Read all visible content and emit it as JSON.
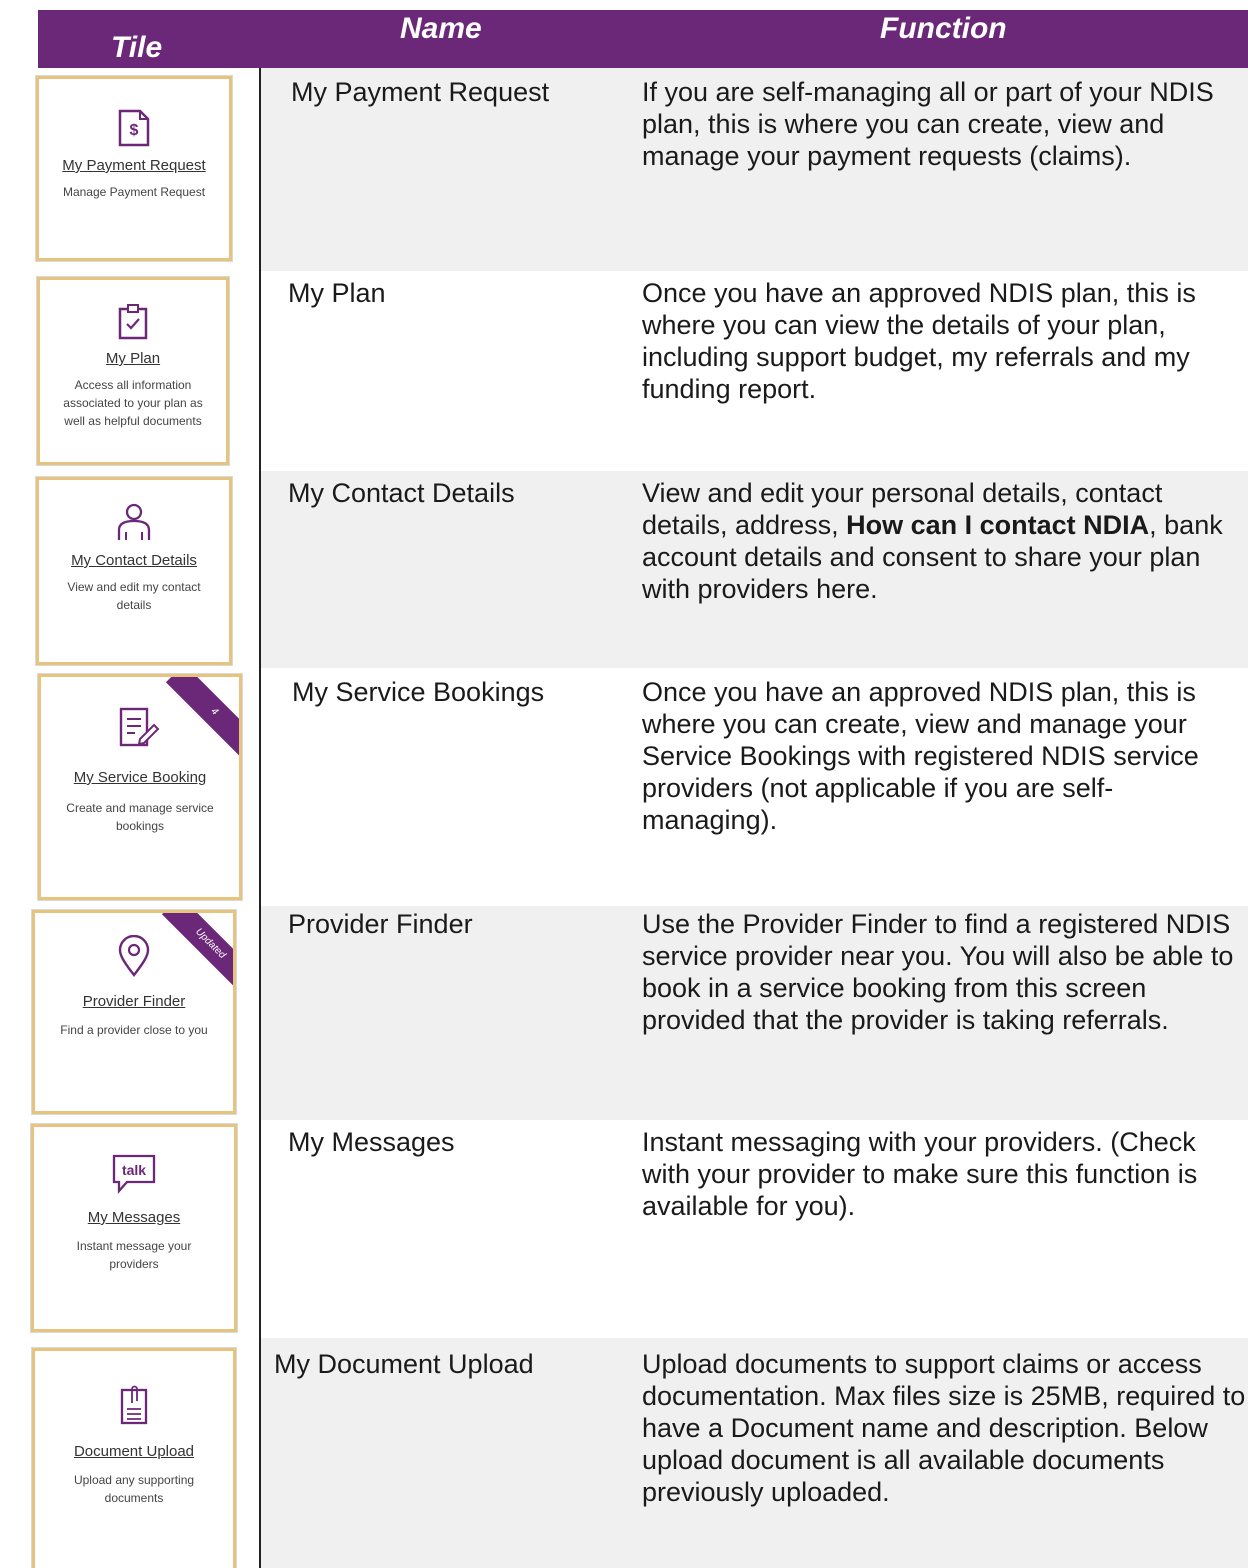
{
  "header": {
    "tile": "Tile",
    "name": "Name",
    "function": "Function"
  },
  "colors": {
    "header_bg": "#6b2878",
    "tile_border": "#e6c47f",
    "row_shade": "#f0f0f0",
    "ribbon": "#6b2878"
  },
  "rows": [
    {
      "tile": {
        "title": "My Payment Request",
        "desc": "Manage Payment Request",
        "icon": "dollar-document-icon",
        "icon_text": "$"
      },
      "name": "My Payment Request",
      "function": "If you are self-managing all or part of your NDIS plan, this is where you can create, view and manage your payment requests (claims)."
    },
    {
      "tile": {
        "title": "My Plan",
        "desc": "Access all information associated to your plan as well as helpful documents",
        "icon": "clipboard-check-icon"
      },
      "name": "My Plan",
      "function": "Once you have an approved NDIS plan, this is where you can view the details of your plan, including support budget, my referrals and my funding report."
    },
    {
      "tile": {
        "title": "My Contact Details",
        "desc": "View and edit my contact details",
        "icon": "person-icon"
      },
      "name": "My Contact Details",
      "function_before": "View and edit your personal details, contact details, address, ",
      "function_bold": "How can I contact NDIA",
      "function_after": ", bank account details and consent to share your plan with providers here."
    },
    {
      "tile": {
        "title": "My Service Booking",
        "desc": "Create and manage service bookings",
        "icon": "document-edit-icon",
        "badge": "4"
      },
      "name": "My Service Bookings",
      "function": "Once you have an approved NDIS plan, this is where you can create, view and manage your Service Bookings with registered NDIS service providers (not applicable if you are self-managing)."
    },
    {
      "tile": {
        "title": "Provider Finder",
        "desc": "Find a provider close to you",
        "icon": "map-pin-icon",
        "badge": "Updated"
      },
      "name": "Provider Finder",
      "function": "Use the Provider Finder to find a registered NDIS service provider near you. You will also be able to book in a service booking from this screen provided that the provider is taking referrals."
    },
    {
      "tile": {
        "title": "My Messages",
        "desc": "Instant message your providers",
        "icon": "talk-bubble-icon",
        "icon_text": "talk"
      },
      "name": "My Messages",
      "function": "Instant messaging with your providers. (Check with your provider to make sure this function is available for you)."
    },
    {
      "tile": {
        "title": "Document Upload",
        "desc": "Upload any supporting documents",
        "icon": "paperclip-document-icon"
      },
      "name": "My Document Upload",
      "function": "Upload documents to support claims or access documentation. Max files size is 25MB, required to have a Document name and description. Below upload document is all available documents previously uploaded."
    }
  ]
}
